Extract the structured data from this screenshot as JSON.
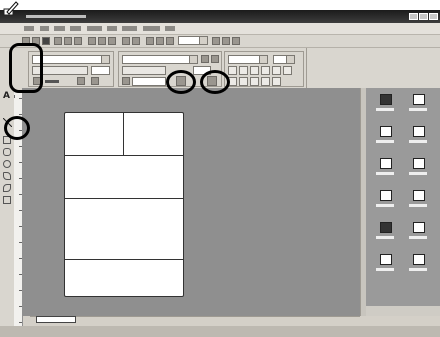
{
  "window": {
    "title": "",
    "bg_color": "#d4d0c8"
  },
  "menubar": {
    "items": [
      "",
      "",
      "",
      "",
      "",
      "",
      "",
      "",
      ""
    ]
  },
  "toolbar": {
    "font_name": "",
    "font_size": "",
    "format_select": "",
    "zoom": ""
  },
  "tools": {
    "text_glyph": "A"
  },
  "sheet_tab": {
    "label": ""
  },
  "right_panel": {
    "items": [
      "",
      "",
      "",
      "",
      "",
      "",
      "",
      "",
      "",
      "",
      "",
      "",
      "",
      ""
    ]
  },
  "canvas": {
    "bg_color": "#8f8f8f",
    "label_color": "#ffffff"
  },
  "highlights": {
    "circle_color": "#000000"
  }
}
